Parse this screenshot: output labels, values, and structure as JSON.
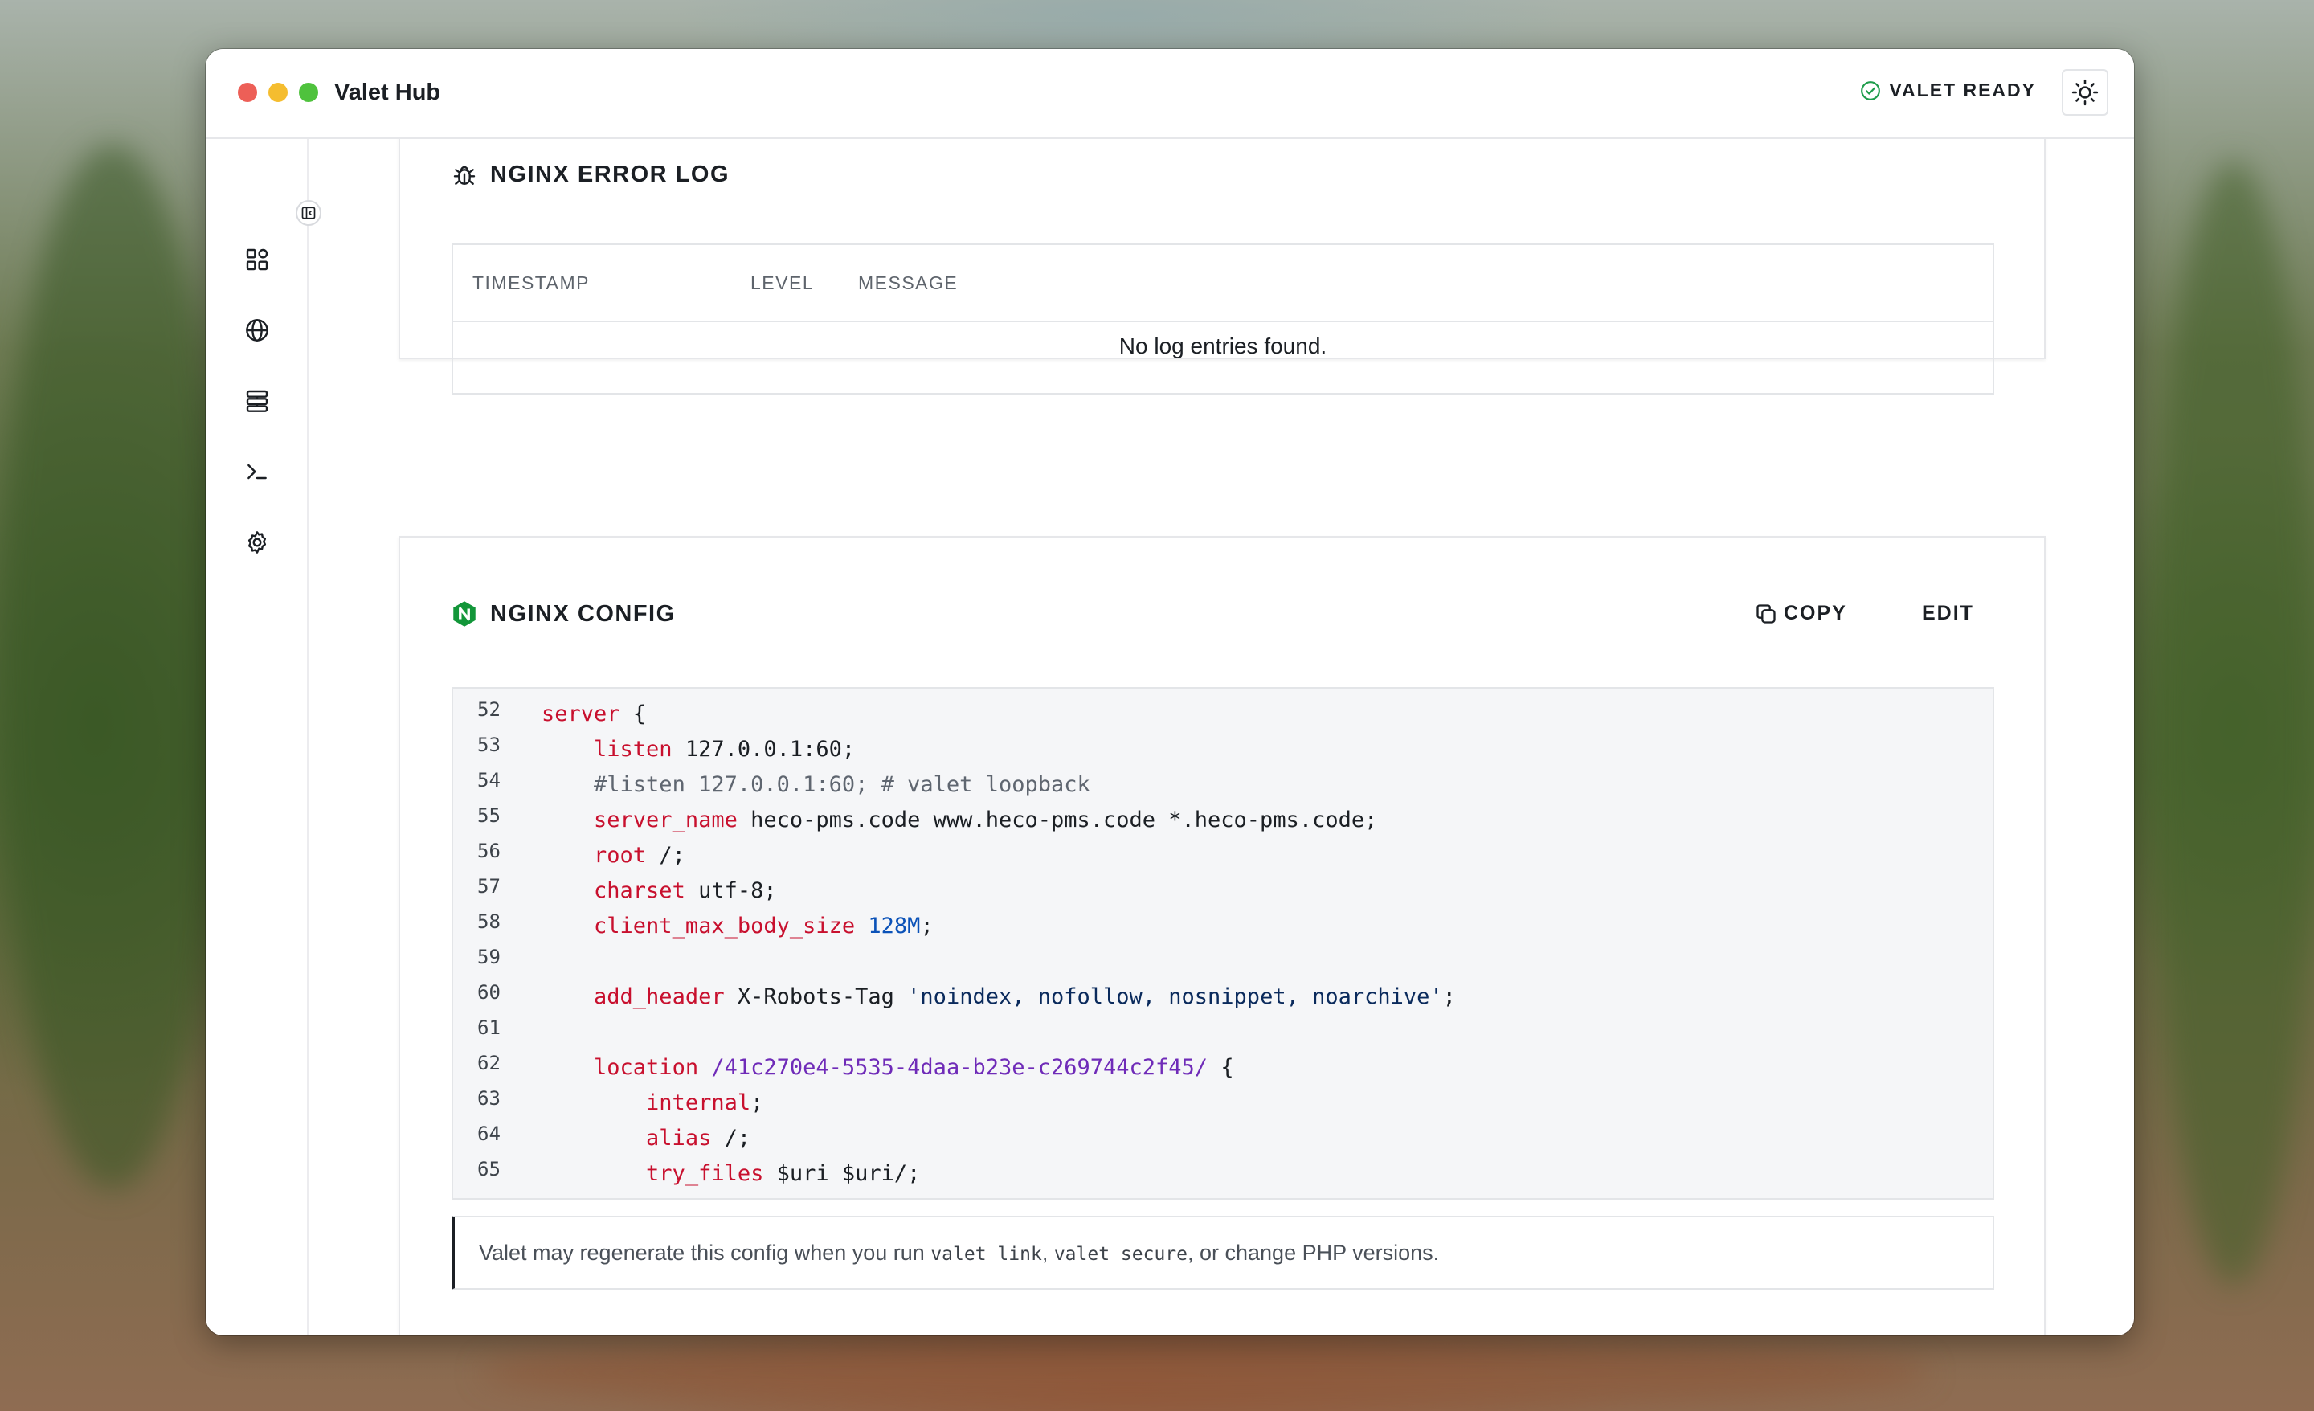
{
  "app": {
    "title": "Valet Hub"
  },
  "status": {
    "label": "VALET READY",
    "color": "#1f9d4c"
  },
  "sidebar": {
    "items": [
      {
        "icon": "dashboard-icon"
      },
      {
        "icon": "globe-icon"
      },
      {
        "icon": "server-icon"
      },
      {
        "icon": "terminal-icon"
      },
      {
        "icon": "gear-icon"
      }
    ]
  },
  "error_log": {
    "title": "NGINX ERROR LOG",
    "columns": [
      "TIMESTAMP",
      "LEVEL",
      "MESSAGE"
    ],
    "empty_text": "No log entries found."
  },
  "config": {
    "title": "NGINX CONFIG",
    "copy_label": "COPY",
    "edit_label": "EDIT",
    "lines": [
      {
        "n": "52",
        "segs": [
          [
            "kw",
            "server"
          ],
          [
            "",
            " {"
          ]
        ]
      },
      {
        "n": "53",
        "segs": [
          [
            "",
            "    "
          ],
          [
            "kw",
            "listen"
          ],
          [
            "",
            " 127.0.0.1:60;"
          ]
        ]
      },
      {
        "n": "54",
        "segs": [
          [
            "",
            "    "
          ],
          [
            "cmt",
            "#listen 127.0.0.1:60; # valet loopback"
          ]
        ]
      },
      {
        "n": "55",
        "segs": [
          [
            "",
            "    "
          ],
          [
            "kw",
            "server_name"
          ],
          [
            "",
            " heco-pms.code www.heco-pms.code *.heco-pms.code;"
          ]
        ]
      },
      {
        "n": "56",
        "segs": [
          [
            "",
            "    "
          ],
          [
            "kw",
            "root"
          ],
          [
            "",
            " /;"
          ]
        ]
      },
      {
        "n": "57",
        "segs": [
          [
            "",
            "    "
          ],
          [
            "kw",
            "charset"
          ],
          [
            "",
            " utf-8;"
          ]
        ]
      },
      {
        "n": "58",
        "segs": [
          [
            "",
            "    "
          ],
          [
            "kw",
            "client_max_body_size"
          ],
          [
            "",
            " "
          ],
          [
            "num",
            "128M"
          ],
          [
            "",
            ";"
          ]
        ]
      },
      {
        "n": "59",
        "segs": []
      },
      {
        "n": "60",
        "segs": [
          [
            "",
            "    "
          ],
          [
            "kw",
            "add_header"
          ],
          [
            "",
            " X-Robots-Tag "
          ],
          [
            "str",
            "'noindex, nofollow, nosnippet, noarchive'"
          ],
          [
            "",
            ";"
          ]
        ]
      },
      {
        "n": "61",
        "segs": []
      },
      {
        "n": "62",
        "segs": [
          [
            "",
            "    "
          ],
          [
            "kw",
            "location"
          ],
          [
            "",
            " "
          ],
          [
            "path",
            "/41c270e4-5535-4daa-b23e-c269744c2f45/"
          ],
          [
            "",
            " {"
          ]
        ]
      },
      {
        "n": "63",
        "segs": [
          [
            "",
            "        "
          ],
          [
            "kw",
            "internal"
          ],
          [
            "",
            ";"
          ]
        ]
      },
      {
        "n": "64",
        "segs": [
          [
            "",
            "        "
          ],
          [
            "kw",
            "alias"
          ],
          [
            "",
            " /;"
          ]
        ]
      },
      {
        "n": "65",
        "segs": [
          [
            "",
            "        "
          ],
          [
            "kw",
            "try_files"
          ],
          [
            "",
            " $uri $uri/;"
          ]
        ]
      }
    ],
    "note": {
      "before": "Valet may regenerate this config when you run ",
      "cmd1": "valet link",
      "sep": ", ",
      "cmd2": "valet secure",
      "after": ", or change PHP versions."
    }
  }
}
